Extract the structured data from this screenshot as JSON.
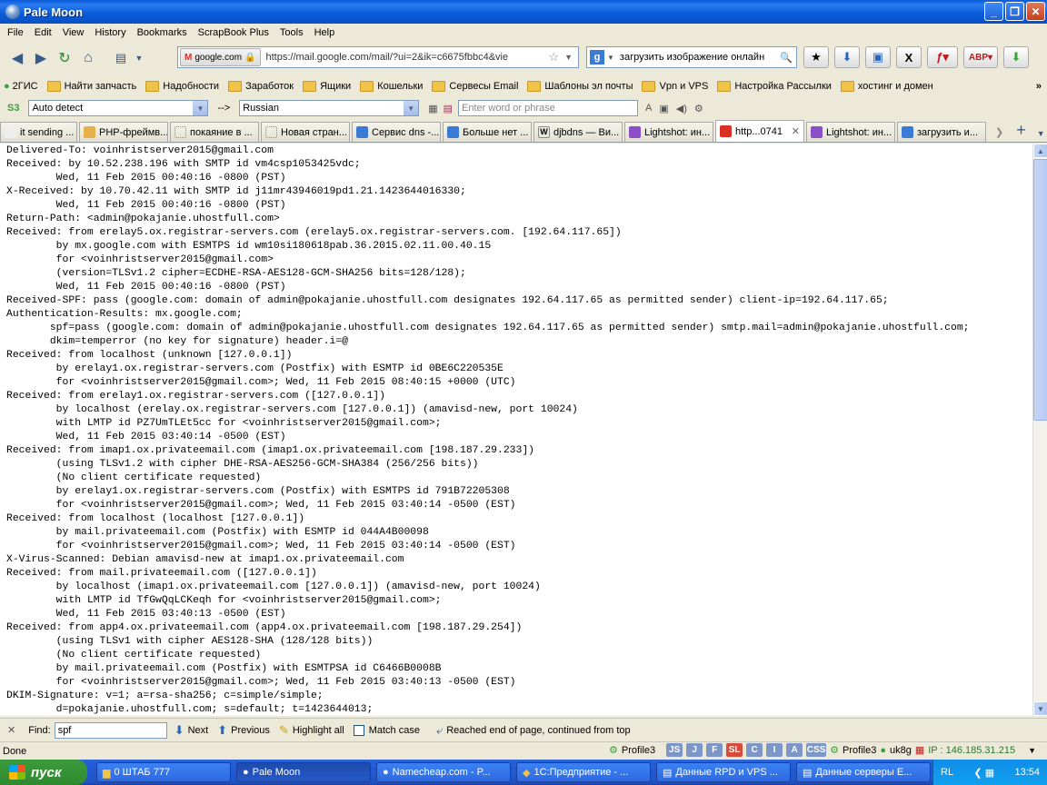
{
  "window": {
    "title": "Pale Moon"
  },
  "menu": [
    "File",
    "Edit",
    "View",
    "History",
    "Bookmarks",
    "ScrapBook Plus",
    "Tools",
    "Help"
  ],
  "nav": {
    "identity_label": "google.com",
    "url": "https://mail.google.com/mail/?ui=2&ik=c6675fbbc4&vie",
    "search_text": "загрузить изображение онлайн"
  },
  "bookmarks": [
    "2ГИС",
    "Найти запчасть",
    "Надобности",
    "Заработок",
    "Ящики",
    "Кошельки",
    "Сервесы Email",
    "Шаблоны эл почты",
    "Vpn и VPS",
    "Настройка Рассылки",
    "хостинг и домен"
  ],
  "translate": {
    "from": "Auto detect",
    "arrow": "-->",
    "to": "Russian",
    "placeholder": "Enter word or phrase"
  },
  "tabs": [
    {
      "label": "it sending ...",
      "color": "#ffffff",
      "active": false
    },
    {
      "label": "PHP-фреймв...",
      "color": "#e8b04a",
      "active": false
    },
    {
      "label": "покаяние в ...",
      "color": "#ffffff",
      "active": false
    },
    {
      "label": "Новая стран...",
      "color": "#ffffff",
      "active": false
    },
    {
      "label": "Сервис dns -...",
      "color": "#3a7bd5",
      "active": false
    },
    {
      "label": "Больше нет ...",
      "color": "#3a7bd5",
      "active": false
    },
    {
      "label": "djbdns — Ви...",
      "color": "#ffffff",
      "active": false
    },
    {
      "label": "Lightshot: ин...",
      "color": "#8a4fc8",
      "active": false
    },
    {
      "label": "http...0741",
      "color": "#d93025",
      "active": true
    },
    {
      "label": "Lightshot: ин...",
      "color": "#8a4fc8",
      "active": false
    },
    {
      "label": "загрузить и...",
      "color": "#3a7bd5",
      "active": false
    }
  ],
  "headers": "Delivered-To: voinhristserver2015@gmail.com\nReceived: by 10.52.238.196 with SMTP id vm4csp1053425vdc;\n        Wed, 11 Feb 2015 00:40:16 -0800 (PST)\nX-Received: by 10.70.42.11 with SMTP id j11mr43946019pd1.21.1423644016330;\n        Wed, 11 Feb 2015 00:40:16 -0800 (PST)\nReturn-Path: <admin@pokajanie.uhostfull.com>\nReceived: from erelay5.ox.registrar-servers.com (erelay5.ox.registrar-servers.com. [192.64.117.65])\n        by mx.google.com with ESMTPS id wm10si180618pab.36.2015.02.11.00.40.15\n        for <voinhristserver2015@gmail.com>\n        (version=TLSv1.2 cipher=ECDHE-RSA-AES128-GCM-SHA256 bits=128/128);\n        Wed, 11 Feb 2015 00:40:16 -0800 (PST)\nReceived-SPF: pass (google.com: domain of admin@pokajanie.uhostfull.com designates 192.64.117.65 as permitted sender) client-ip=192.64.117.65;\nAuthentication-Results: mx.google.com;\n       spf=pass (google.com: domain of admin@pokajanie.uhostfull.com designates 192.64.117.65 as permitted sender) smtp.mail=admin@pokajanie.uhostfull.com;\n       dkim=temperror (no key for signature) header.i=@\nReceived: from localhost (unknown [127.0.0.1])\n        by erelay1.ox.registrar-servers.com (Postfix) with ESMTP id 0BE6C220535E\n        for <voinhristserver2015@gmail.com>; Wed, 11 Feb 2015 08:40:15 +0000 (UTC)\nReceived: from erelay1.ox.registrar-servers.com ([127.0.0.1])\n        by localhost (erelay.ox.registrar-servers.com [127.0.0.1]) (amavisd-new, port 10024)\n        with LMTP id PZ7UmTLEt5cc for <voinhristserver2015@gmail.com>;\n        Wed, 11 Feb 2015 03:40:14 -0500 (EST)\nReceived: from imap1.ox.privateemail.com (imap1.ox.privateemail.com [198.187.29.233])\n        (using TLSv1.2 with cipher DHE-RSA-AES256-GCM-SHA384 (256/256 bits))\n        (No client certificate requested)\n        by erelay1.ox.registrar-servers.com (Postfix) with ESMTPS id 791B72205308\n        for <voinhristserver2015@gmail.com>; Wed, 11 Feb 2015 03:40:14 -0500 (EST)\nReceived: from localhost (localhost [127.0.0.1])\n        by mail.privateemail.com (Postfix) with ESMTP id 044A4B00098\n        for <voinhristserver2015@gmail.com>; Wed, 11 Feb 2015 03:40:14 -0500 (EST)\nX-Virus-Scanned: Debian amavisd-new at imap1.ox.privateemail.com\nReceived: from mail.privateemail.com ([127.0.0.1])\n        by localhost (imap1.ox.privateemail.com [127.0.0.1]) (amavisd-new, port 10024)\n        with LMTP id TfGwQqLCKeqh for <voinhristserver2015@gmail.com>;\n        Wed, 11 Feb 2015 03:40:13 -0500 (EST)\nReceived: from app4.ox.privateemail.com (app4.ox.privateemail.com [198.187.29.254])\n        (using TLSv1 with cipher AES128-SHA (128/128 bits))\n        (No client certificate requested)\n        by mail.privateemail.com (Postfix) with ESMTPSA id C6466B0008B\n        for <voinhristserver2015@gmail.com>; Wed, 11 Feb 2015 03:40:13 -0500 (EST)\nDKIM-Signature: v=1; a=rsa-sha256; c=simple/simple;\n        d=pokajanie.uhostfull.com; s=default; t=1423644013;",
  "find": {
    "label": "Find:",
    "value": "spf",
    "next": "Next",
    "previous": "Previous",
    "highlight": "Highlight all",
    "match_case": "Match case",
    "status": "Reached end of page, continued from top"
  },
  "status": {
    "text": "Done",
    "profile_left": "Profile3",
    "badges": [
      "JS",
      "J",
      "F",
      "SL",
      "C",
      "I",
      "A",
      "CSS"
    ],
    "profile_right": "Profile3",
    "user": "uk8g",
    "ip": "IP : 146.185.31.215"
  },
  "taskbar": {
    "start": "пуск",
    "items": [
      "0 ШТАБ 777",
      "Pale Moon",
      "Namecheap.com - P...",
      "1С:Предприятие - ...",
      "Данные RPD и VPS ...",
      "Данные серверы E..."
    ],
    "lang": "RL",
    "clock": "13:54"
  }
}
